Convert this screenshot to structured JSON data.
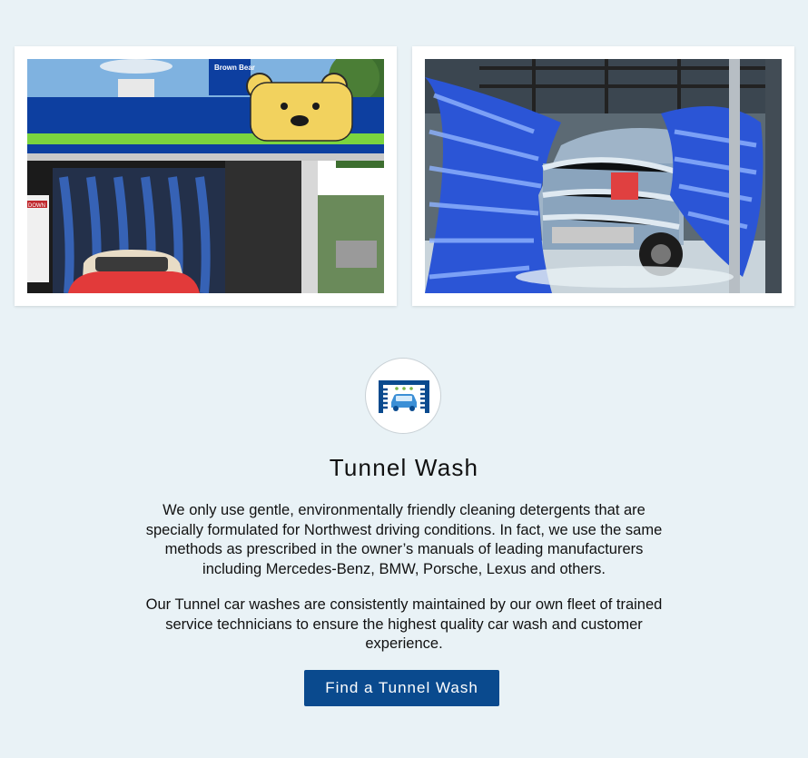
{
  "photos": {
    "left_sign_text": "Brown Bear",
    "left_banner_text": "DOWN"
  },
  "section": {
    "title": "Tunnel Wash",
    "paragraphs": [
      "We only use gentle, environmentally friendly cleaning detergents that are specially formulated for Northwest driving conditions. In fact, we use the same methods as prescribed in the owner’s manuals of leading manufacturers including Mercedes-Benz, BMW, Porsche, Lexus and others.",
      "Our Tunnel car washes are consistently maintained by our own fleet of trained service technicians to ensure the highest quality car wash and customer experience."
    ],
    "cta_label": "Find a Tunnel Wash"
  },
  "icons": {
    "section_icon": "tunnel-wash-icon"
  },
  "colors": {
    "page_background": "#e9f2f6",
    "button_background": "#0a4a8e",
    "button_text": "#ffffff",
    "icon_blue": "#0a4a8e",
    "icon_light_blue": "#3b8fd6",
    "icon_green": "#7ab648"
  }
}
